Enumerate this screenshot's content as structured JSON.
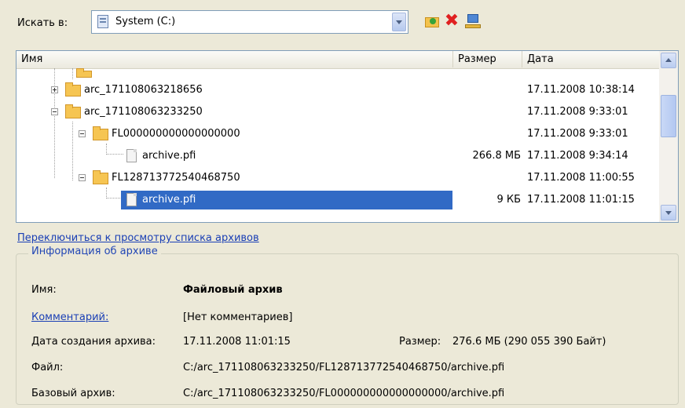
{
  "search": {
    "label": "Искать в:",
    "location": "System (C:)"
  },
  "list": {
    "columns": {
      "name": "Имя",
      "size": "Размер",
      "date": "Дата"
    },
    "rows": [
      {
        "name": "arc_171108063218656",
        "size": "",
        "date": "17.11.2008 10:38:14",
        "type": "folder",
        "expanded": false
      },
      {
        "name": "arc_171108063233250",
        "size": "",
        "date": "17.11.2008 9:33:01",
        "type": "folder",
        "expanded": true
      },
      {
        "name": "FL000000000000000000",
        "size": "",
        "date": "17.11.2008 9:33:01",
        "type": "folder",
        "expanded": true
      },
      {
        "name": "archive.pfi",
        "size": "266.8 МБ",
        "date": "17.11.2008 9:34:14",
        "type": "file"
      },
      {
        "name": "FL128713772540468750",
        "size": "",
        "date": "17.11.2008 11:00:55",
        "type": "folder",
        "expanded": true
      },
      {
        "name": "archive.pfi",
        "size": "9 КБ",
        "date": "17.11.2008 11:01:15",
        "type": "file",
        "selected": true
      }
    ]
  },
  "switch_link": "Переключиться к просмотру списка архивов",
  "info": {
    "title": "Информация об архиве",
    "name_label": "Имя:",
    "name_value": "Файловый архив",
    "comment_label": "Комментарий:",
    "comment_value": "[Нет комментариев]",
    "created_label": "Дата создания архива:",
    "created_value": "17.11.2008 11:01:15",
    "size_label": "Размер:",
    "size_value": "276.6 МБ (290 055 390 Байт)",
    "file_label": "Файл:",
    "file_value": "C:/arc_171108063233250/FL128713772540468750/archive.pfi",
    "base_label": "Базовый архив:",
    "base_value": "C:/arc_171108063233250/FL000000000000000000/archive.pfi"
  }
}
